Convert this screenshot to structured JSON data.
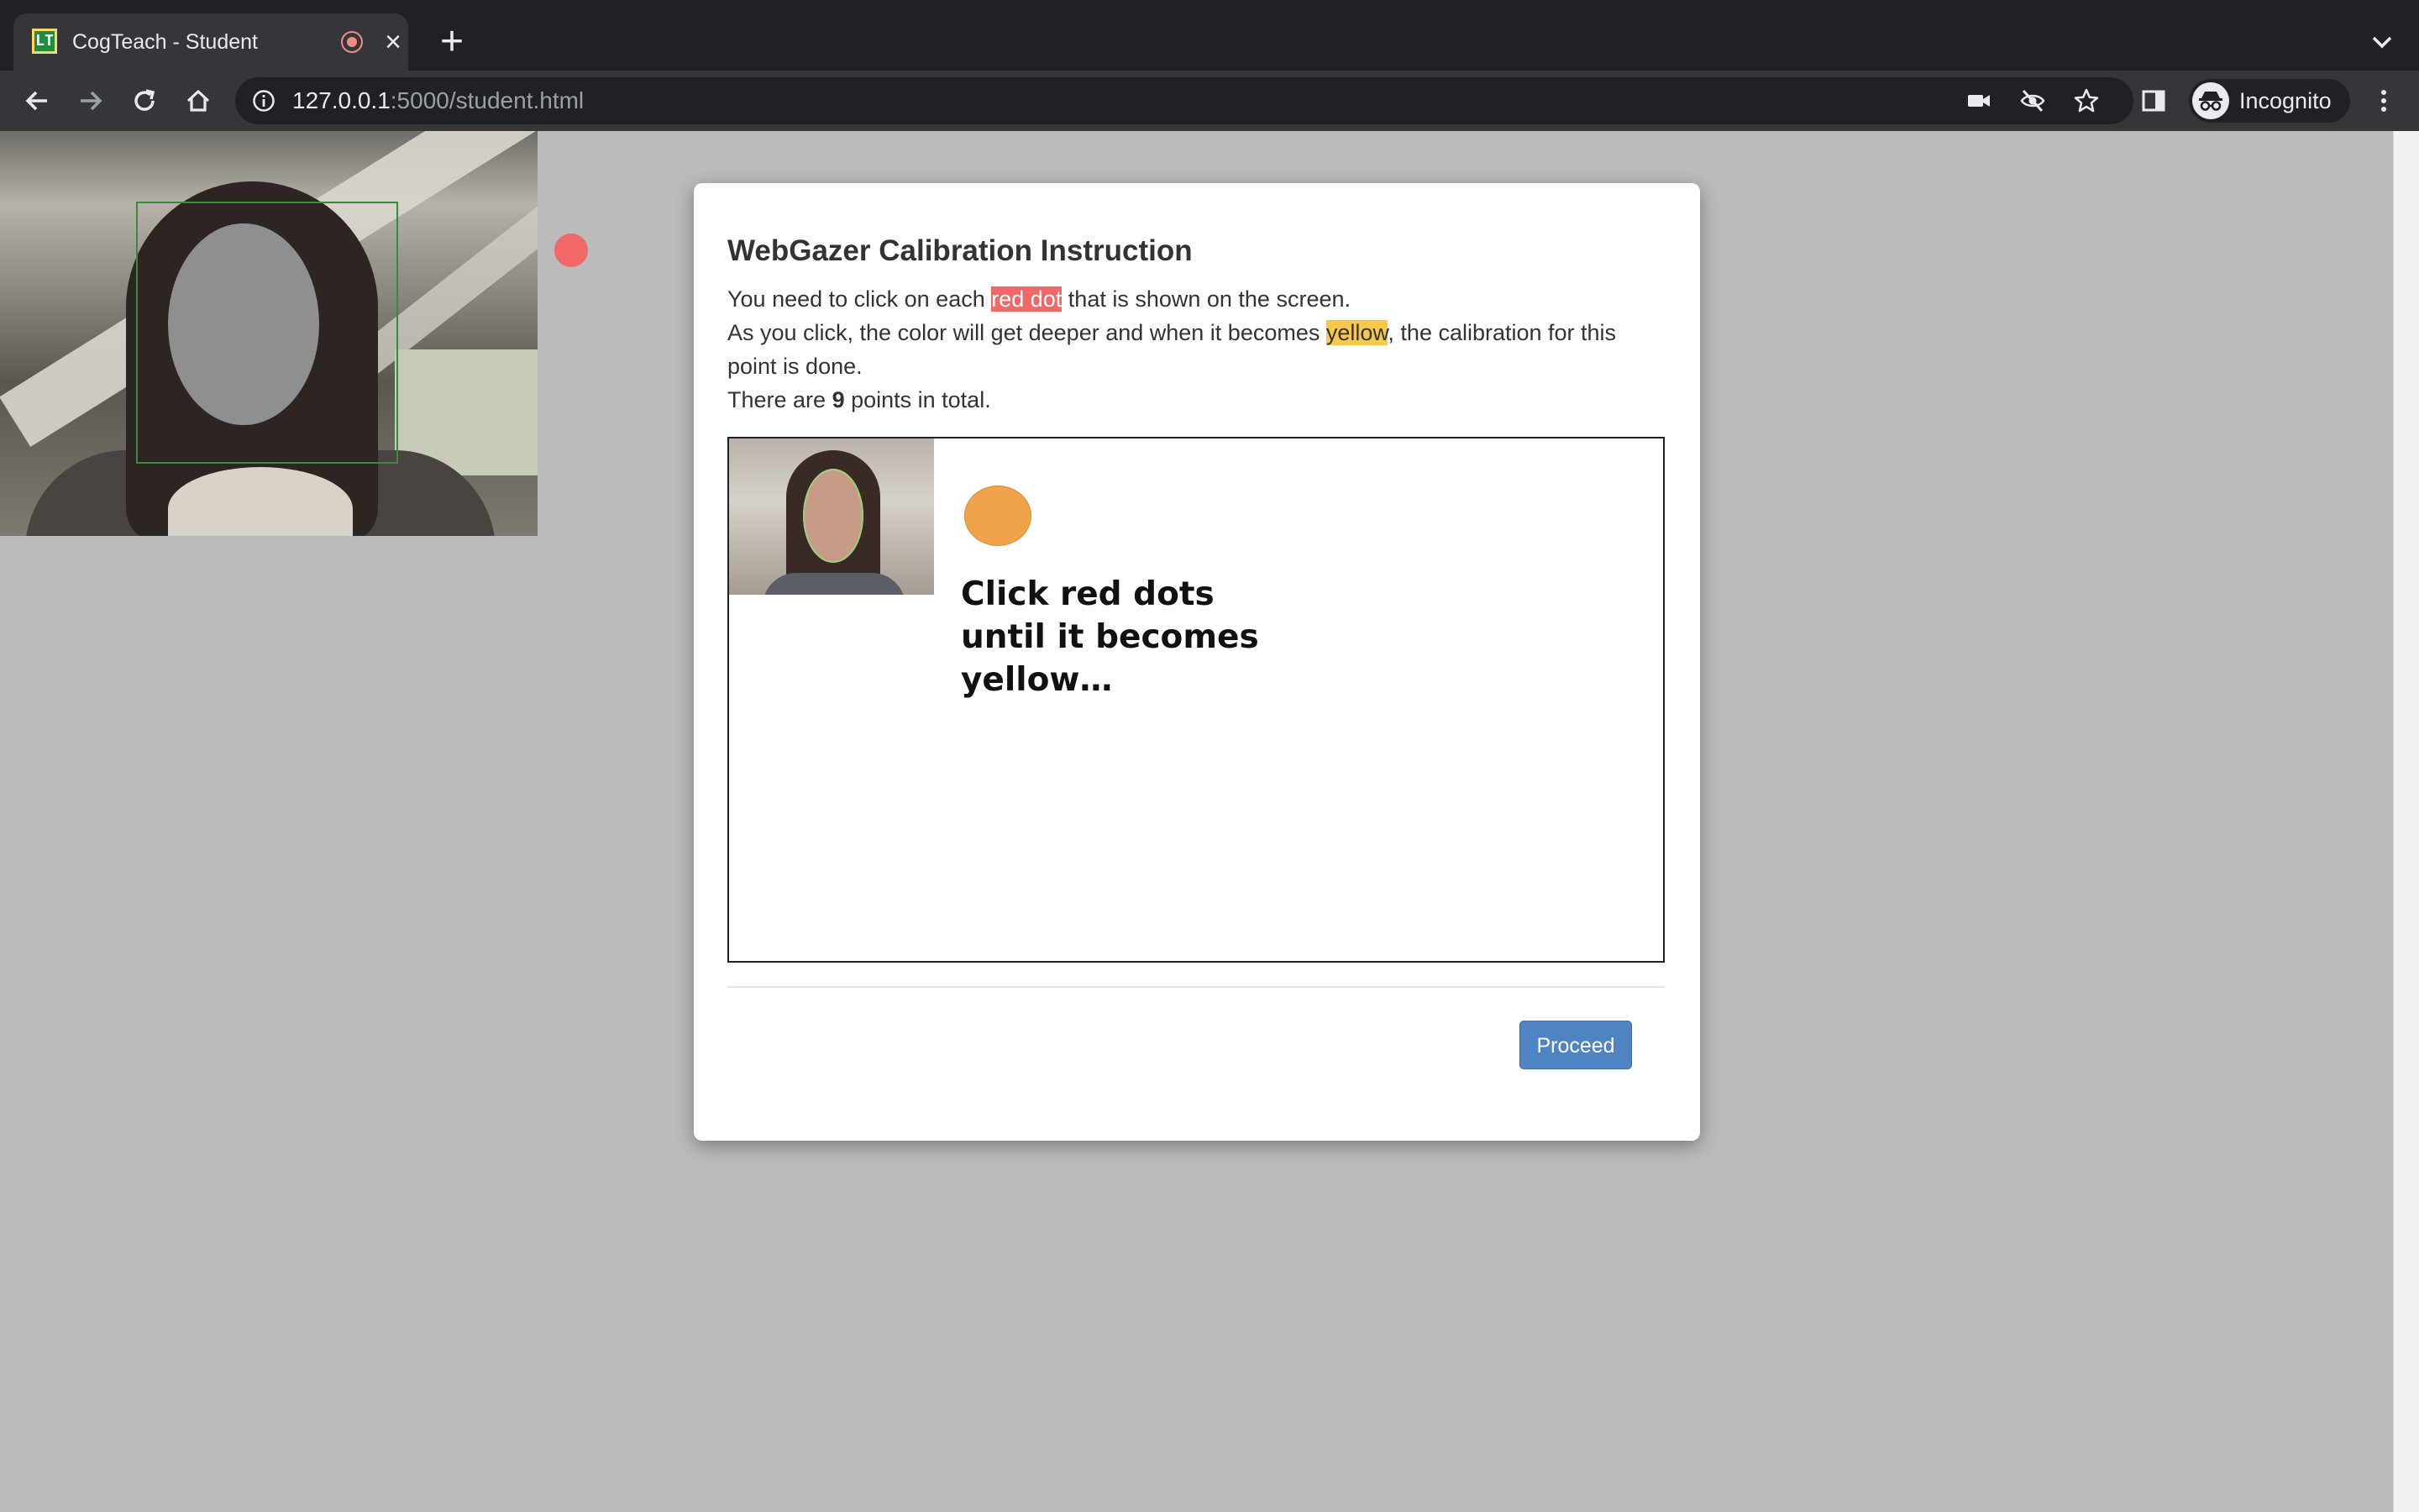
{
  "browser": {
    "tab": {
      "favicon_text": "LT",
      "title": "CogTeach - Student",
      "recording_indicator": "recording-icon",
      "close_icon": "close-icon"
    },
    "new_tab_icon": "plus-icon",
    "tab_search_icon": "chevron-down-icon",
    "nav": {
      "back_icon": "arrow-left-icon",
      "forward_icon": "arrow-right-icon",
      "reload_icon": "reload-icon",
      "home_icon": "home-icon"
    },
    "url": {
      "host": "127.0.0.1",
      "rest": ":5000/student.html"
    },
    "omnibox_icons": [
      "camera-icon",
      "eye-off-icon",
      "star-icon"
    ],
    "side_panel_icon": "side-panel-icon",
    "profile_label": "Incognito",
    "menu_icon": "kebab-menu-icon",
    "colors": {
      "tabstrip": "#202124",
      "toolbar": "#35363a",
      "text": "#e8eaed"
    }
  },
  "page": {
    "background": "#bbbbbb",
    "calibration_dot_color": "#f06868"
  },
  "modal": {
    "title": "WebGazer Calibration Instruction",
    "line1_pre": "You need to click on each ",
    "line1_highlight": "red dot",
    "line1_post": " that is shown on the screen.",
    "line2_pre": "As you click, the color will get deeper and when it becomes ",
    "line2_highlight": "yellow",
    "line2_post": ", the calibration for this point is done.",
    "line3_pre": "There are ",
    "line3_bold": "9",
    "line3_post": " points in total.",
    "demo_caption": "Click red dots until it becomes yellow…",
    "proceed_label": "Proceed",
    "colors": {
      "red_highlight": "#f06868",
      "yellow_highlight": "#f7c948",
      "demo_dot": "#f0a24a",
      "button": "#4f84c4"
    }
  }
}
